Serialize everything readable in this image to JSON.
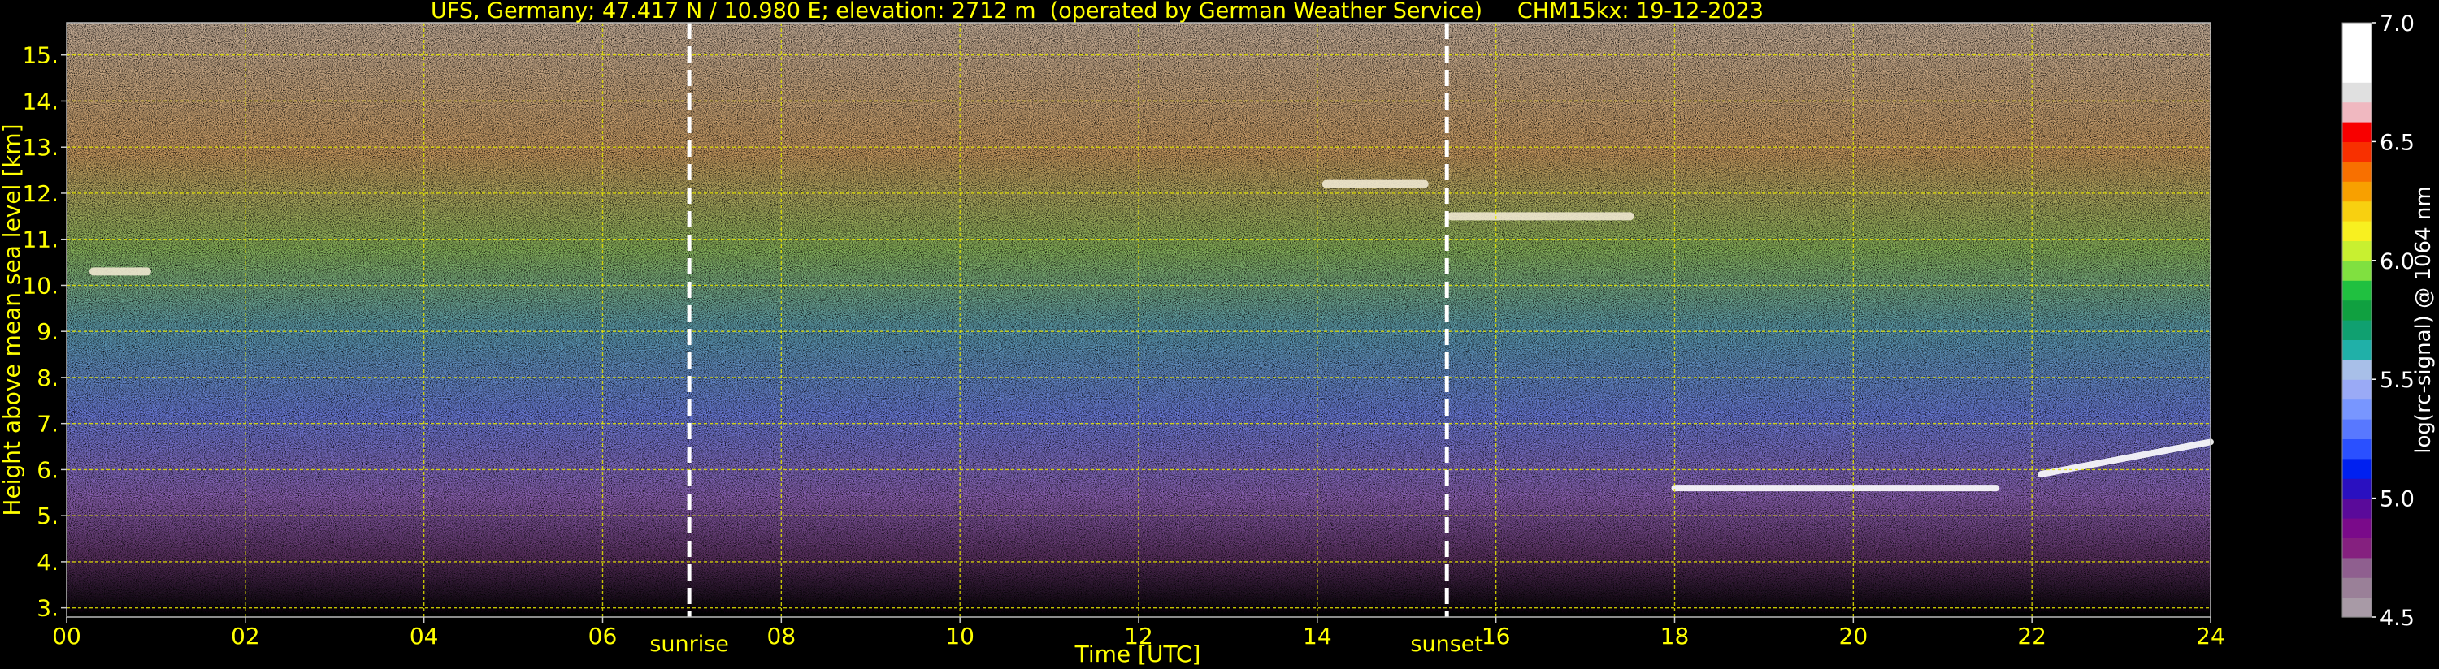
{
  "chart_data": {
    "type": "heatmap",
    "title": "UFS, Germany; 47.417 N / 10.980 E; elevation: 2712 m  (operated by German Weather Service)     CHM15kx: 19-12-2023",
    "xlabel": "Time [UTC]",
    "ylabel": "Height above mean sea level [km]",
    "xlim": [
      0,
      24
    ],
    "ylim": [
      2.8,
      15.7
    ],
    "x_ticks": [
      0,
      2,
      4,
      6,
      8,
      10,
      12,
      14,
      16,
      18,
      20,
      22,
      24
    ],
    "x_tick_labels": [
      "00",
      "02",
      "04",
      "06",
      "08",
      "10",
      "12",
      "14",
      "16",
      "18",
      "20",
      "22",
      "24"
    ],
    "y_ticks": [
      3,
      4,
      5,
      6,
      7,
      8,
      9,
      10,
      11,
      12,
      13,
      14,
      15
    ],
    "y_tick_labels": [
      "3.",
      "4.",
      "5.",
      "6.",
      "7.",
      "8.",
      "9.",
      "10.",
      "11.",
      "12.",
      "13.",
      "14.",
      "15."
    ],
    "grid": true,
    "markers": [
      {
        "label": "sunrise",
        "time": 6.97
      },
      {
        "label": "sunset",
        "time": 15.45
      }
    ],
    "colorbar": {
      "label": "log(rc-signal) @ 1064 nm",
      "min": 4.5,
      "max": 7.0,
      "ticks": [
        4.5,
        5.0,
        5.5,
        6.0,
        6.5,
        7.0
      ],
      "tick_labels": [
        "4.5",
        "5.0",
        "5.5",
        "6.0",
        "6.5",
        "7.0"
      ],
      "colors": [
        "#a89aa6",
        "#9a8098",
        "#8f5f8f",
        "#85207f",
        "#7a0a8a",
        "#5a0a9a",
        "#2a10c0",
        "#0020f0",
        "#2a50ff",
        "#5878ff",
        "#7896ff",
        "#9aaaf6",
        "#a8bfe8",
        "#20b0a8",
        "#10a070",
        "#10a040",
        "#20c040",
        "#80e040",
        "#c8f030",
        "#f8f020",
        "#f8d010",
        "#f8a000",
        "#f87000",
        "#f83000",
        "#f80000",
        "#f0b8c0",
        "#e0e0e0",
        "#ffffff",
        "#ffffff",
        "#ffffff"
      ]
    },
    "features": [
      {
        "kind": "low cloud layer",
        "t_start": 18.0,
        "t_end": 21.6,
        "height_km": 5.6
      },
      {
        "kind": "low cloud layer",
        "t_start": 22.1,
        "t_end": 24.0,
        "height_km_start": 5.9,
        "height_km_end": 6.6
      },
      {
        "kind": "cirrus",
        "t_start": 14.1,
        "t_end": 15.2,
        "height_km": 12.2
      },
      {
        "kind": "cirrus",
        "t_start": 15.5,
        "t_end": 17.5,
        "height_km": 11.5
      },
      {
        "kind": "cirrus",
        "t_start": 0.3,
        "t_end": 0.9,
        "height_km": 10.3
      }
    ]
  },
  "colors": {
    "label": "#ffff00",
    "grid": "#e6e600",
    "background": "#000000"
  }
}
